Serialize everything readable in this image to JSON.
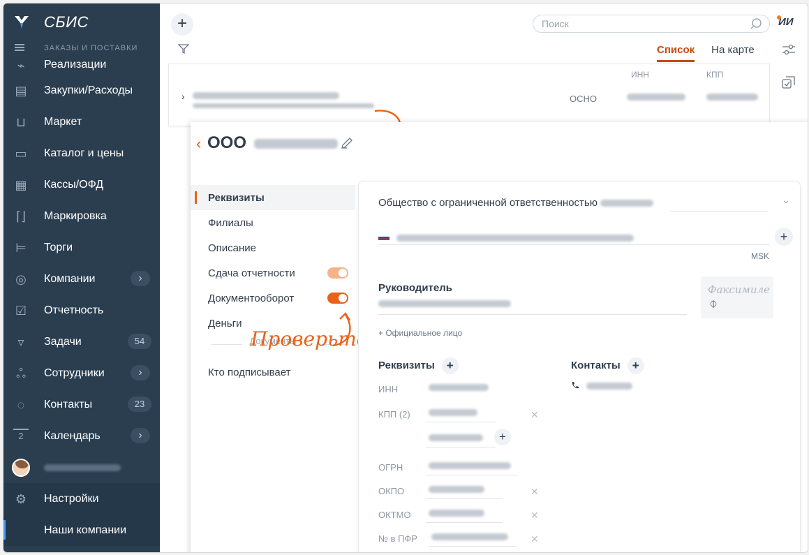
{
  "sidebar": {
    "brand": "СБИС",
    "section": "ЗАКАЗЫ И ПОСТАВКИ",
    "items": [
      {
        "label": "Реализации"
      },
      {
        "label": "Закупки/Расходы"
      },
      {
        "label": "Маркет"
      },
      {
        "label": "Каталог и цены"
      },
      {
        "label": "Кассы/ОФД"
      },
      {
        "label": "Маркировка"
      },
      {
        "label": "Торги"
      },
      {
        "label": "Компании"
      },
      {
        "label": "Отчетность"
      },
      {
        "label": "Задачи",
        "count": "54"
      },
      {
        "label": "Сотрудники"
      },
      {
        "label": "Контакты",
        "count": "23"
      },
      {
        "label": "Календарь",
        "day": "2"
      },
      {
        "label": "Настройки"
      },
      {
        "label": "Наши компании"
      }
    ]
  },
  "header": {
    "search_placeholder": "Поиск",
    "user_initials": "ИИ",
    "tabs": [
      {
        "label": "Список"
      },
      {
        "label": "На карте"
      }
    ]
  },
  "list": {
    "col_inn": "ИНН",
    "col_kpp": "КПП",
    "tax_mode": "ОСНО"
  },
  "panel": {
    "title": "ООО",
    "nav": [
      {
        "label": "Реквизиты"
      },
      {
        "label": "Филиалы"
      },
      {
        "label": "Описание"
      },
      {
        "label": "Сдача отчетности"
      },
      {
        "label": "Документооборот"
      },
      {
        "label": "Деньги"
      }
    ],
    "nav_section": "Документы",
    "nav_signer": "Кто подписывает",
    "annotation": "Проверьте",
    "card": {
      "org_type": "Общество с ограниченной ответственностью",
      "timezone": "MSK",
      "director_label": "Руководитель",
      "signature_text": "Факсимиле",
      "official_link": "+ Официальное лицо",
      "requisites_label": "Реквизиты",
      "contacts_label": "Контакты",
      "fields": {
        "inn": "ИНН",
        "kpp": "КПП (2)",
        "ogrn": "ОГРН",
        "okpo": "ОКПО",
        "oktmo": "ОКТМО",
        "pfr": "№ в ПФР"
      }
    }
  }
}
